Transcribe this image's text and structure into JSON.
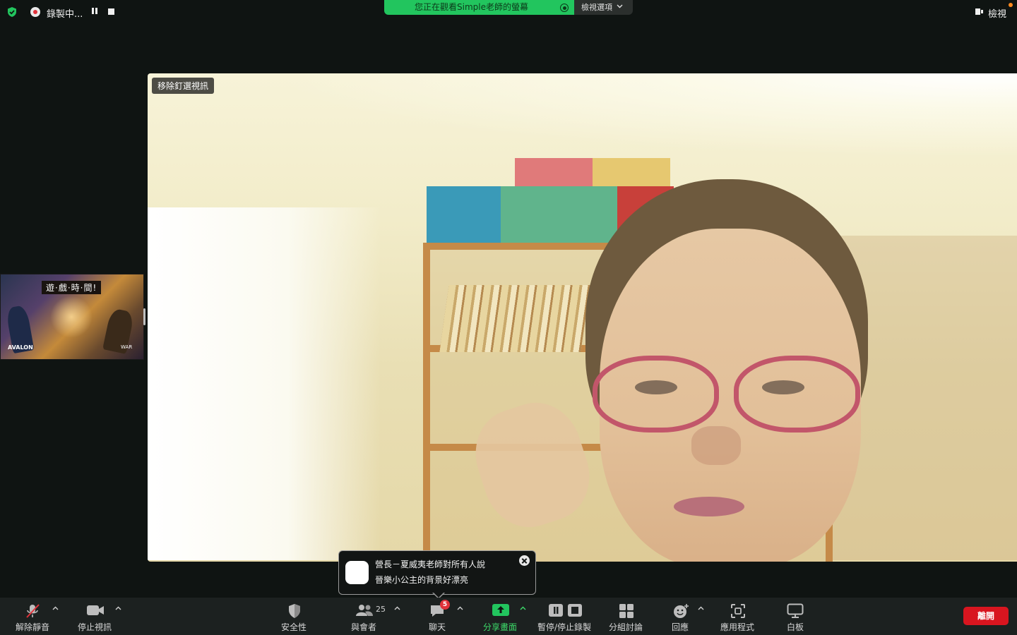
{
  "colors": {
    "share_banner_bg": "#22c55e",
    "leave_bg": "#d8151f",
    "badge_bg": "#e0313a",
    "share_icon_green": "#22c55e",
    "security_shield": "#22c55e"
  },
  "top_bar": {
    "recording_status": "錄製中...",
    "share_banner": "您正在觀看Simple老師的螢幕",
    "view_options": "檢視選項",
    "view_button": "檢視"
  },
  "thumbnail": {
    "title": "遊·戲·時·間!",
    "logo_left": "AVALON",
    "logo_right": "WAR"
  },
  "main_video": {
    "unpin_label": "移除釘選視訊"
  },
  "chat_toast": {
    "sender": "營長－夏威夷老師對所有人說",
    "message": "晉樂小公主的背景好漂亮"
  },
  "toolbar": {
    "unmute": "解除靜音",
    "stop_video": "停止視訊",
    "security": "安全性",
    "participants": "與會者",
    "participants_count": "25",
    "chat": "聊天",
    "chat_badge": "5",
    "share_screen": "分享畫面",
    "pause_stop_recording": "暫停/停止錄製",
    "breakout_rooms": "分組討論",
    "reactions": "回應",
    "apps": "應用程式",
    "whiteboard": "白板",
    "leave": "離開"
  },
  "icons": {
    "security_badge": "shield-check-icon",
    "recording": "record-icon",
    "mic_muted": "mic-off-icon",
    "video": "video-camera-icon",
    "participants": "people-icon",
    "chat": "chat-bubble-icon",
    "share": "share-arrow-icon",
    "recording_controls": "pause-stop-icon",
    "breakout": "grid-icon",
    "reactions": "smiley-plus-icon",
    "apps": "apps-icon",
    "whiteboard": "whiteboard-icon"
  }
}
